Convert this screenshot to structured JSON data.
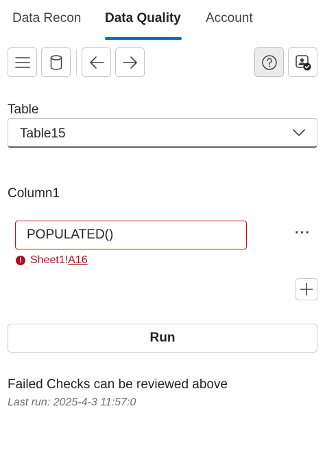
{
  "tabs": [
    {
      "label": "Data Recon",
      "active": false
    },
    {
      "label": "Data Quality",
      "active": true
    },
    {
      "label": "Account",
      "active": false
    }
  ],
  "toolbar": {
    "buttons": [
      {
        "icon": "hamburger-menu-icon"
      },
      {
        "icon": "database-icon"
      },
      {
        "icon": "arrow-left-icon"
      },
      {
        "icon": "arrow-right-icon"
      },
      {
        "icon": "help-icon",
        "pressed": true
      },
      {
        "icon": "user-verified-icon"
      }
    ]
  },
  "table": {
    "label": "Table",
    "selected": "Table15"
  },
  "column": {
    "label": "Column1",
    "rule_value": "POPULATED()",
    "error_prefix": "Sheet1!",
    "error_link": "A16"
  },
  "actions": {
    "run_label": "Run"
  },
  "status": {
    "message": "Failed Checks can be reviewed above",
    "last_run": "Last run: 2025-4-3 11:57:0"
  },
  "colors": {
    "accent": "#0f6cbd",
    "error": "#c50f1f"
  }
}
